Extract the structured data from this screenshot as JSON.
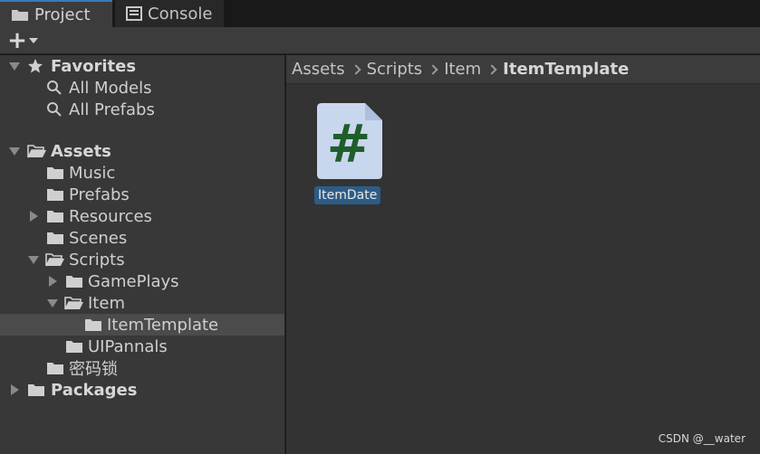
{
  "tabs": [
    {
      "label": "Project",
      "icon": "folder-icon",
      "active": true
    },
    {
      "label": "Console",
      "icon": "console-icon",
      "active": false
    }
  ],
  "toolbar": {
    "add_icon": "plus-icon"
  },
  "tree": {
    "favorites": {
      "label": "Favorites",
      "items": [
        "All Models",
        "All Prefabs"
      ]
    },
    "assets": {
      "label": "Assets",
      "music": "Music",
      "prefabs": "Prefabs",
      "resources": "Resources",
      "scenes": "Scenes",
      "scripts": "Scripts",
      "gameplays": "GamePlays",
      "item": "Item",
      "itemtemplate": "ItemTemplate",
      "uipannals": "UIPannals",
      "lock": "密码锁"
    },
    "packages": "Packages"
  },
  "breadcrumb": [
    "Assets",
    "Scripts",
    "Item",
    "ItemTemplate"
  ],
  "asset": {
    "name": "ItemDate",
    "glyph": "#",
    "icon": "csharp-script-icon"
  },
  "watermark": "CSDN @__water",
  "colors": {
    "accent": "#3a79bb",
    "selection": "#2c5d87",
    "script_glyph": "#1f5e2a",
    "script_bg": "#c9d7ee"
  }
}
